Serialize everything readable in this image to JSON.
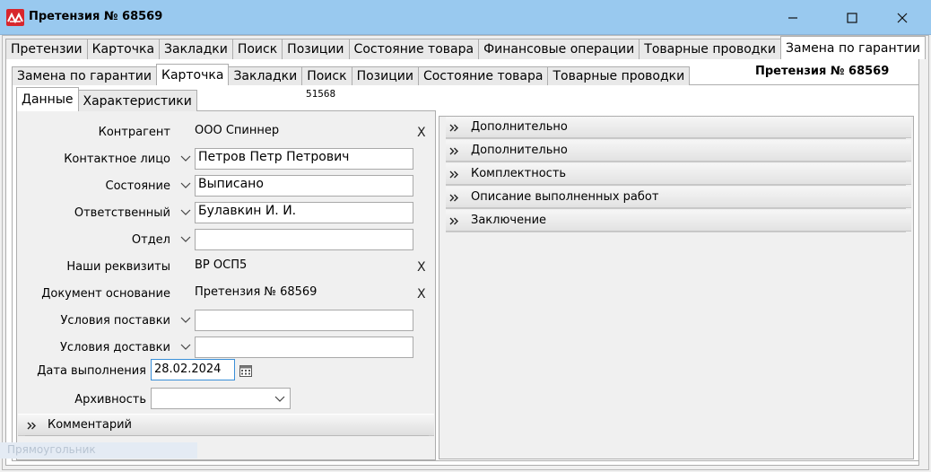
{
  "window": {
    "title": "Претензия № 68569",
    "icon": "app-logo-icon"
  },
  "tabs_level1": [
    "Претензии",
    "Карточка",
    "Закладки",
    "Поиск",
    "Позиции",
    "Состояние товара",
    "Финансовые операции",
    "Товарные проводки",
    "Замена по гарантии"
  ],
  "tabs_level2": [
    "Замена по гарантии",
    "Карточка",
    "Закладки",
    "Поиск",
    "Позиции",
    "Состояние товара",
    "Товарные проводки"
  ],
  "tabs_level3": [
    "Данные",
    "Характеристики"
  ],
  "header": {
    "claim_title": "Претензия № 68569",
    "claim_number": "51568"
  },
  "form": {
    "contractor": {
      "label": "Контрагент",
      "value": "ООО Спиннер"
    },
    "contact": {
      "label": "Контактное лицо",
      "value": "Петров Петр Петрович"
    },
    "state": {
      "label": "Состояние",
      "value": "Выписано"
    },
    "responsible": {
      "label": "Ответственный",
      "value": "Булавкин И. И."
    },
    "department": {
      "label": "Отдел",
      "value": ""
    },
    "requisites": {
      "label": "Наши реквизиты",
      "value": "ВР ОСП5"
    },
    "base_document": {
      "label": "Документ основание",
      "value": "Претензия № 68569"
    },
    "supply_terms": {
      "label": "Условия поставки",
      "value": ""
    },
    "delivery_terms": {
      "label": "Условия доставки",
      "value": ""
    },
    "completion_date": {
      "label": "Дата выполнения",
      "value": "28.02.2024"
    },
    "archive": {
      "label": "Архивность",
      "value": ""
    },
    "clear_symbol": "X"
  },
  "comment_section": {
    "label": "Комментарий"
  },
  "faded_label": "Прямоугольник",
  "right_sections": [
    "Дополнительно",
    "Дополнительно",
    "Комплектность",
    "Описание выполненных работ",
    "Заключение"
  ],
  "colors": {
    "titlebar": "#99c9ef",
    "logo": "#d8262c",
    "focus_border": "#3a8fd8"
  }
}
